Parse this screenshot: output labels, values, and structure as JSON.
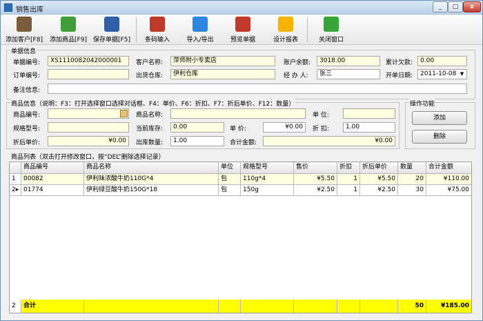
{
  "window": {
    "title": "销售出库",
    "min": "_",
    "max": "□",
    "close": "x"
  },
  "toolbar": [
    {
      "label": "添加客户[F8]",
      "icon": "person-add-icon",
      "color": "#7a5b3a"
    },
    {
      "label": "添加商品[F9]",
      "icon": "gift-add-icon",
      "color": "#3f9e3a"
    },
    {
      "label": "保存单据[F5]",
      "icon": "save-icon",
      "color": "#2f5fa8"
    },
    {
      "label": "条码输入",
      "icon": "barcode-printer-icon",
      "color": "#c0392b"
    },
    {
      "label": "导入/导出",
      "icon": "import-export-icon",
      "color": "#2e86de"
    },
    {
      "label": "预览单据",
      "icon": "print-preview-icon",
      "color": "#c0392b"
    },
    {
      "label": "设计报表",
      "icon": "star-icon",
      "color": "#f5b400"
    },
    {
      "label": "关闭窗口",
      "icon": "exit-arrow-icon",
      "color": "#38a538"
    }
  ],
  "doc": {
    "group_label": "单据信息",
    "no_label": "单据编号:",
    "no": "XS1110082042000001",
    "customer_label": "客户名称:",
    "customer": "萍师附小专卖店",
    "balance_label": "账户余额:",
    "balance": "3018.00",
    "debt_label": "累计欠款:",
    "debt": "0.00",
    "order_label": "订单编号:",
    "order": "",
    "warehouse_label": "出货仓库:",
    "warehouse": "伊利仓库",
    "handler_label": "经 办 人:",
    "handler": "张三",
    "date_label": "开单日期:",
    "date": "2011-10-08",
    "remark_label": "备注信息:",
    "remark": ""
  },
  "product": {
    "group_label": "商品信息（说明：F3：打开选择窗口选择对话框、F4：单价、F6：折扣、F7：折后单价、F12：数量）",
    "code_label": "商品编号:",
    "code": "",
    "name_label": "商品名称:",
    "name": "",
    "unit_label": "单    位:",
    "unit": "",
    "spec_label": "规格型号:",
    "spec": "",
    "stock_label": "当前库存:",
    "stock": "0.00",
    "price_label": "单    价:",
    "price": "¥0.00",
    "discount_label": "折    扣:",
    "discount": "1.00",
    "disc_price_label": "折后单价:",
    "disc_price": "¥0.00",
    "qty_label": "出库数量:",
    "qty": "1.00",
    "amount_label": "合计金额:",
    "amount": "¥0.00"
  },
  "ops": {
    "group_label": "操作功能",
    "add": "添加",
    "delete": "删除"
  },
  "list": {
    "group_label": "商品列表（双击打开修改窗口，按“DEL”删除选择记录）",
    "columns": [
      "商品编号",
      "商品名称",
      "单位",
      "规格型号",
      "售价",
      "折扣",
      "折后单价",
      "数量",
      "合计金额"
    ],
    "rows": [
      {
        "idx": "1",
        "code": "00082",
        "name": "伊利味浓酸牛奶110G*4",
        "unit": "包",
        "spec": "110g*4",
        "price": "¥5.50",
        "discount": "1",
        "disc_price": "¥5.50",
        "qty": "20",
        "total": "¥110.00"
      },
      {
        "idx": "2",
        "code": "01774",
        "name": "伊利绿豆酸牛奶150G*18",
        "unit": "包",
        "spec": "150g",
        "price": "¥2.50",
        "discount": "1",
        "disc_price": "¥2.50",
        "qty": "30",
        "total": "¥75.00"
      }
    ],
    "total_row": {
      "idx": "2",
      "label": "合计",
      "qty": "50",
      "total": "¥185.00"
    }
  }
}
